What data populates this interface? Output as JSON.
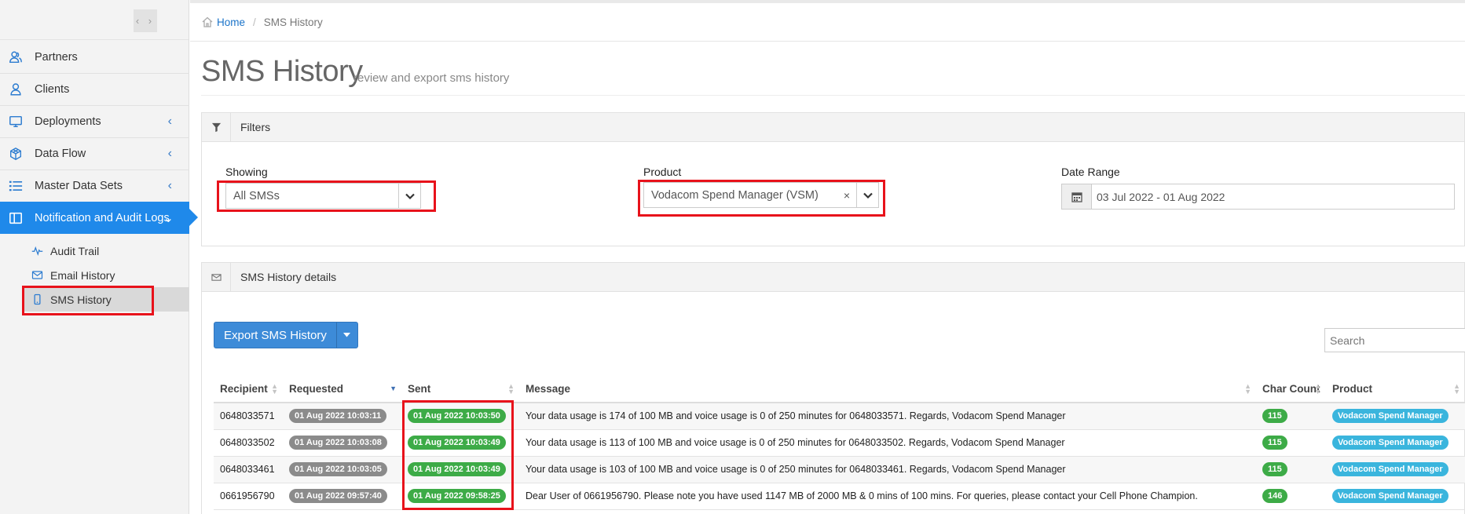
{
  "sidebar": {
    "toggle_label": "‹ ›",
    "items": [
      {
        "label": "Partners",
        "icon": "partners-icon"
      },
      {
        "label": "Clients",
        "icon": "user-icon"
      },
      {
        "label": "Deployments",
        "icon": "monitor-icon"
      },
      {
        "label": "Data Flow",
        "icon": "cube-icon"
      },
      {
        "label": "Master Data Sets",
        "icon": "list-icon"
      },
      {
        "label": "Notification and Audit Logs",
        "icon": "columns-icon"
      }
    ],
    "sub_items": [
      {
        "label": "Audit Trail",
        "icon": "pulse-icon"
      },
      {
        "label": "Email History",
        "icon": "envelope-icon"
      },
      {
        "label": "SMS History",
        "icon": "mobile-icon"
      }
    ]
  },
  "breadcrumb": {
    "home": "Home",
    "current": "SMS History"
  },
  "page": {
    "title": "SMS History",
    "subtitle": "review and export sms history"
  },
  "filters": {
    "heading": "Filters",
    "showing_label": "Showing",
    "showing_value": "All SMSs",
    "product_label": "Product",
    "product_value": "Vodacom Spend Manager (VSM)",
    "product_clear": "×",
    "date_label": "Date Range",
    "date_value": "03 Jul 2022 - 01 Aug 2022"
  },
  "details": {
    "heading": "SMS History details",
    "export_label": "Export SMS History",
    "search_placeholder": "Search"
  },
  "table": {
    "headers": [
      "Recipient",
      "Requested",
      "Sent",
      "Message",
      "Char Count",
      "Product"
    ],
    "rows": [
      {
        "recipient": "0648033571",
        "requested": "01 Aug 2022 10:03:11",
        "sent": "01 Aug 2022 10:03:50",
        "message": "Your data usage is 174 of 100 MB and voice usage is 0 of 250 minutes for 0648033571. Regards, Vodacom Spend Manager",
        "chars": "115",
        "product": "Vodacom Spend Manager"
      },
      {
        "recipient": "0648033502",
        "requested": "01 Aug 2022 10:03:08",
        "sent": "01 Aug 2022 10:03:49",
        "message": "Your data usage is 113 of 100 MB and voice usage is 0 of 250 minutes for 0648033502. Regards, Vodacom Spend Manager",
        "chars": "115",
        "product": "Vodacom Spend Manager"
      },
      {
        "recipient": "0648033461",
        "requested": "01 Aug 2022 10:03:05",
        "sent": "01 Aug 2022 10:03:49",
        "message": "Your data usage is 103 of 100 MB and voice usage is 0 of 250 minutes for 0648033461. Regards, Vodacom Spend Manager",
        "chars": "115",
        "product": "Vodacom Spend Manager"
      },
      {
        "recipient": "0661956790",
        "requested": "01 Aug 2022 09:57:40",
        "sent": "01 Aug 2022 09:58:25",
        "message": "Dear User of 0661956790. Please note you have used 1147 MB of 2000 MB & 0 mins of 100 mins. For queries, please contact your Cell Phone Champion.",
        "chars": "146",
        "product": "Vodacom Spend Manager"
      }
    ]
  },
  "colors": {
    "accent": "#1f89ea",
    "highlight": "#e8121b",
    "sent_badge": "#3dab47",
    "product_badge": "#3ab5dd"
  }
}
